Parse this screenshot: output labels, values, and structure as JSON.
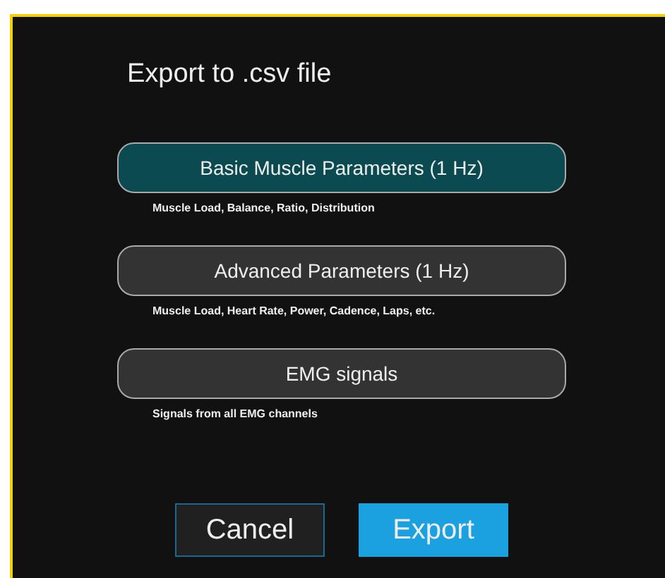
{
  "dialog": {
    "title": "Export to .csv file"
  },
  "options": [
    {
      "label": "Basic Muscle Parameters (1 Hz)",
      "description": "Muscle Load, Balance, Ratio, Distribution",
      "selected": true
    },
    {
      "label": "Advanced Parameters (1 Hz)",
      "description": "Muscle Load, Heart Rate, Power, Cadence, Laps, etc.",
      "selected": false
    },
    {
      "label": "EMG signals",
      "description": "Signals from all EMG channels",
      "selected": false
    }
  ],
  "buttons": [
    {
      "label": "Cancel",
      "kind": "secondary"
    },
    {
      "label": "Export",
      "kind": "primary"
    }
  ]
}
